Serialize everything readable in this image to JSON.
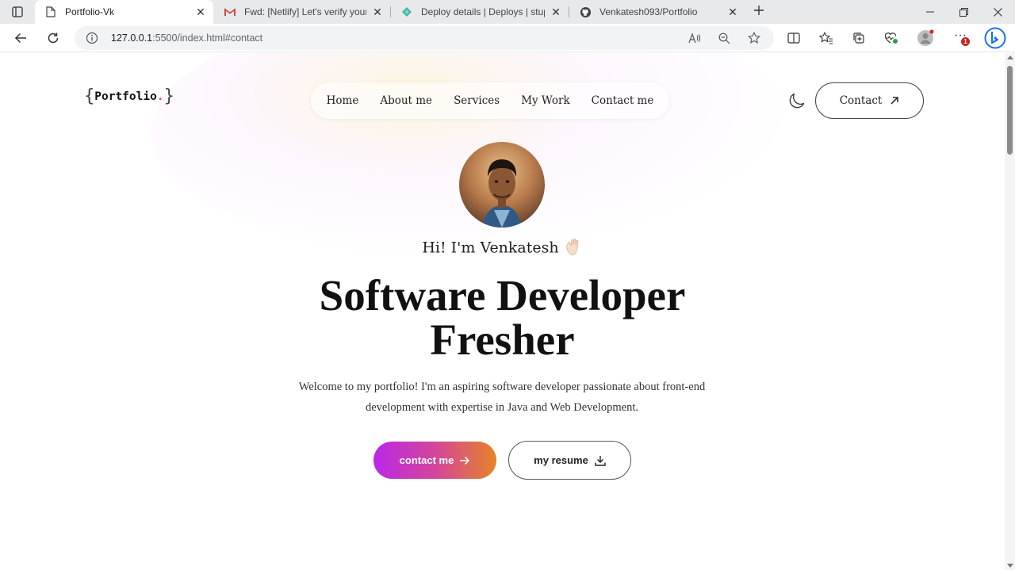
{
  "browser": {
    "tabs": [
      {
        "title": "Portfolio-Vk",
        "icon": "document-icon"
      },
      {
        "title": "Fwd: [Netlify] Let's verify your em",
        "icon": "gmail-icon"
      },
      {
        "title": "Deploy details | Deploys | stupen",
        "icon": "netlify-icon"
      },
      {
        "title": "Venkatesh093/Portfolio",
        "icon": "github-icon"
      }
    ],
    "address": {
      "host": "127.0.0.1",
      "path": ":5500/index.html#contact"
    },
    "notification_count": "1"
  },
  "page": {
    "logo": {
      "text": "Portfolio",
      "dot": "."
    },
    "nav": {
      "home": "Home",
      "about": "About me",
      "services": "Services",
      "work": "My Work",
      "contact": "Contact me"
    },
    "contact_button": "Contact",
    "greeting": "Hi! I'm Venkatesh",
    "headline_line1": "Software Developer",
    "headline_line2": "Fresher",
    "intro": "Welcome to my portfolio! I'm an aspiring software developer passionate about front-end development with expertise in Java and Web Development.",
    "cta_primary": "contact me",
    "cta_secondary": "my resume"
  },
  "colors": {
    "gradient_start": "#b928e6",
    "gradient_mid": "#d4459a",
    "gradient_end": "#e58427",
    "logo_dot": "#e0405e"
  }
}
